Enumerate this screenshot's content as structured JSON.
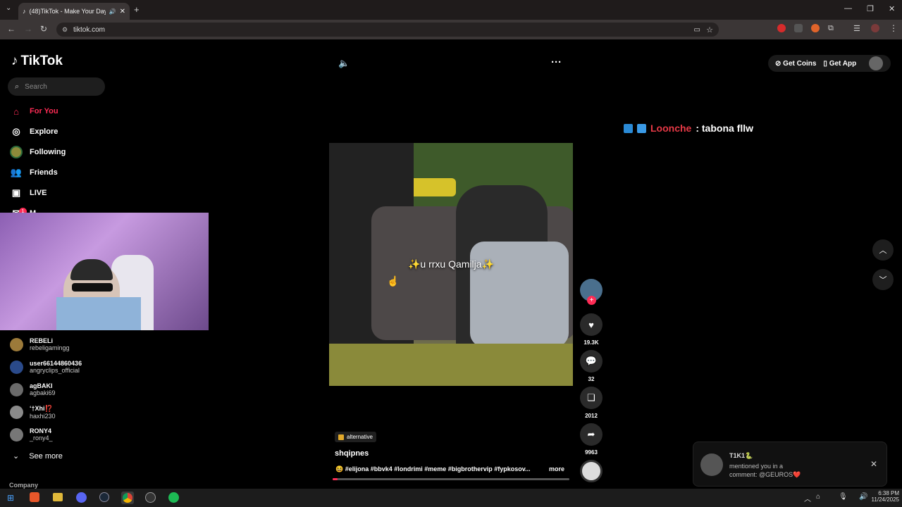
{
  "browser": {
    "tab_title": "(48)TikTok - Make Your Day",
    "url": "tiktok.com"
  },
  "tiktok": {
    "logo_text": "TikTok",
    "search_placeholder": "Search",
    "nav": [
      {
        "label": "For You",
        "icon": "home-icon",
        "active": true
      },
      {
        "label": "Explore",
        "icon": "compass-icon"
      },
      {
        "label": "Following",
        "icon": "following-avatar"
      },
      {
        "label": "Friends",
        "icon": "friends-icon"
      },
      {
        "label": "LIVE",
        "icon": "live-icon"
      },
      {
        "label": "M",
        "icon": "messages-icon",
        "badge": "1"
      }
    ],
    "following_accounts": [
      {
        "name": "REBELi",
        "handle": "rebeligamingg"
      },
      {
        "name": "user66144860436",
        "handle": "angryclips_official"
      },
      {
        "name": "agBAKI",
        "handle": "agbaki69"
      },
      {
        "name": "ʻ†Xhi⁉️",
        "handle": "haxhi230"
      },
      {
        "name": "RONY4",
        "handle": "_rony4_"
      }
    ],
    "see_more": "See more",
    "company": "Company",
    "topright": {
      "get_coins": "Get Coins",
      "get_app": "Get App"
    },
    "video": {
      "overlay_text": "✨u rrxu Qamilja✨",
      "sound_tag": "alternative",
      "username": "shqipnes",
      "description": "😆 #elijona #bbvk4 #londrimi #meme #bigbrothervip #fypkosov...",
      "more_label": "more",
      "likes": "19.3K",
      "comments": "32",
      "saves": "2012",
      "shares": "9963"
    },
    "chat": {
      "user": "Loonche",
      "message": ": tabona fllw"
    },
    "notification": {
      "user": "T1K1🐍",
      "line1": "mentioned you in a",
      "line2": "comment: @GEUROS❤️"
    }
  },
  "taskbar": {
    "time": "6:38 PM",
    "date": "11/24/2025"
  }
}
